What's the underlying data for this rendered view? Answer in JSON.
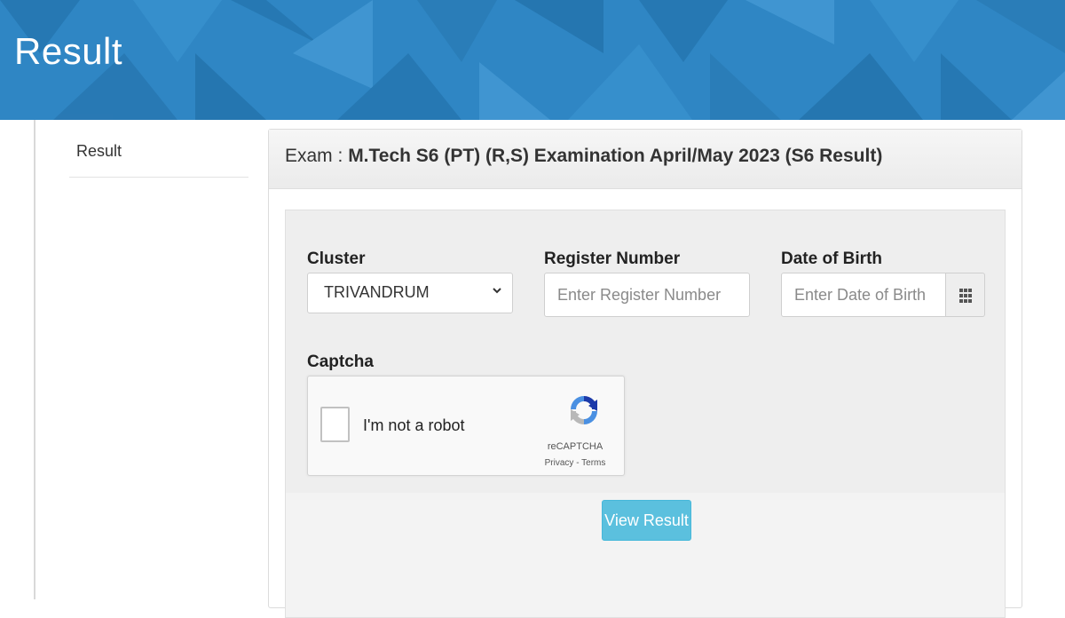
{
  "banner": {
    "title": "Result"
  },
  "sidebar": {
    "items": [
      {
        "label": "Result"
      }
    ]
  },
  "panel": {
    "exam_label": "Exam : ",
    "exam_name": "M.Tech S6 (PT) (R,S) Examination April/May 2023 (S6 Result)"
  },
  "form": {
    "cluster": {
      "label": "Cluster",
      "value": "TRIVANDRUM"
    },
    "register_number": {
      "label": "Register Number",
      "placeholder": "Enter Register Number"
    },
    "date_of_birth": {
      "label": "Date of Birth",
      "placeholder": "Enter Date of Birth",
      "icon": "calendar-grid-icon"
    },
    "captcha": {
      "label": "Captcha",
      "checkbox_text": "I'm not a robot",
      "brand": "reCAPTCHA",
      "links": "Privacy - Terms"
    },
    "submit_label": "View Result"
  },
  "colors": {
    "banner": "#2f86c4",
    "button": "#5bc0de",
    "recaptcha_blue": "#1c3aa9",
    "recaptcha_light": "#4a90e2"
  }
}
